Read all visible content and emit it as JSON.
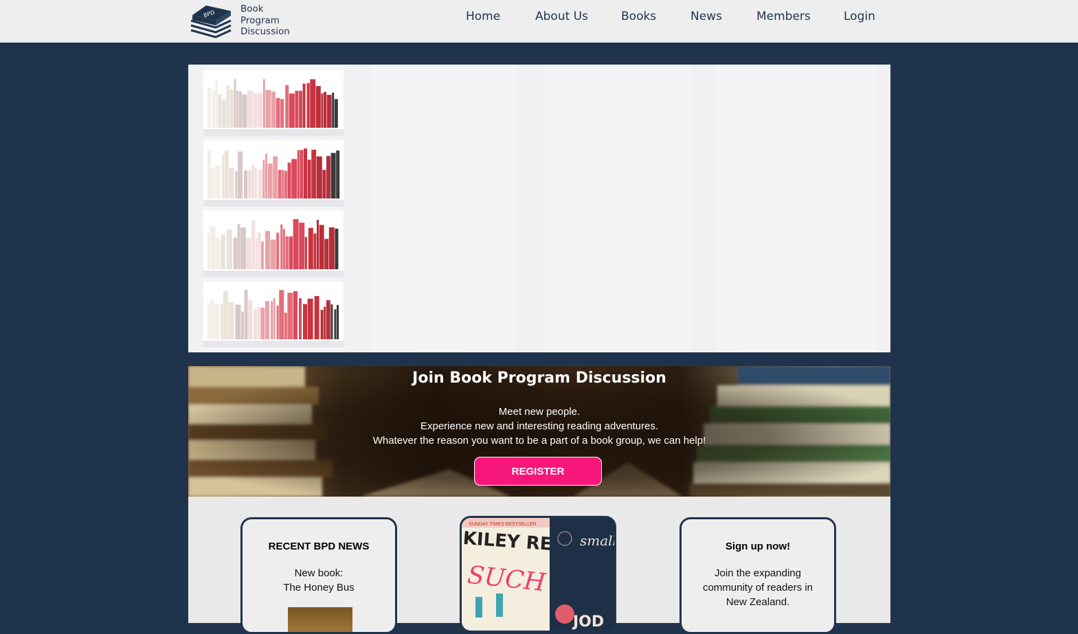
{
  "logo": {
    "badge": "BPD",
    "lines": [
      "Book",
      "Program",
      "Discussion"
    ]
  },
  "nav": [
    "Home",
    "About Us",
    "Books",
    "News",
    "Members",
    "Login"
  ],
  "hero": {
    "image": "colour-sorted-bookshelves"
  },
  "join": {
    "title": "Join Book Program Discussion",
    "lines": [
      "Meet new people.",
      "Experience new and interesting reading adventures.",
      "Whatever the reason you want to be a part of a book group, we can help!"
    ],
    "button": "REGISTER"
  },
  "cards": {
    "news": {
      "title": "RECENT BPD NEWS",
      "line1": "New book:",
      "line2": "The Honey Bus"
    },
    "covers": {
      "book1_author": "KILEY REID",
      "book1_title": "SUCH A FUN",
      "book1_banner": "SUNDAY TIMES BESTSELLER",
      "book2_title": "small great things",
      "book2_author": "JOD"
    },
    "signup": {
      "title": "Sign up now!",
      "line1": "Join the expanding",
      "line2": "community of readers in",
      "line3": "New Zealand."
    }
  },
  "colors": {
    "navy": "#1f344c",
    "header_bg": "#eeeeee",
    "accent_pink": "#f7177a",
    "lower_bg": "#e9e9e9"
  }
}
